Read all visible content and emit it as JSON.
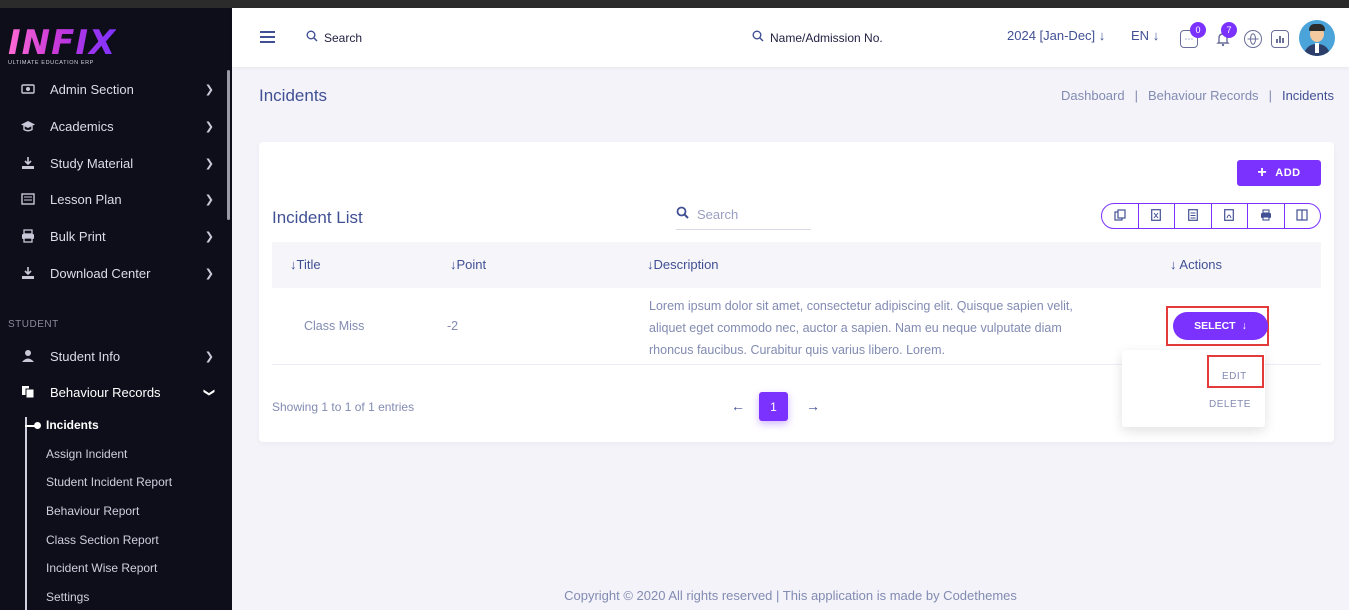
{
  "brand": {
    "logo": "INFIX",
    "tagline": "ULTIMATE EDUCATION ERP"
  },
  "sidebar": {
    "items": [
      {
        "label": "Admin Section",
        "icon": "admin-icon"
      },
      {
        "label": "Academics",
        "icon": "graduation-cap-icon"
      },
      {
        "label": "Study Material",
        "icon": "download-icon"
      },
      {
        "label": "Lesson Plan",
        "icon": "book-icon"
      },
      {
        "label": "Bulk Print",
        "icon": "printer-icon"
      },
      {
        "label": "Download Center",
        "icon": "download-icon"
      }
    ],
    "section_student": "STUDENT",
    "student_items": [
      {
        "label": "Student Info",
        "icon": "user-icon"
      },
      {
        "label": "Behaviour Records",
        "icon": "records-icon"
      }
    ],
    "sub_items": [
      "Incidents",
      "Assign Incident",
      "Student Incident Report",
      "Behaviour Report",
      "Class Section Report",
      "Incident Wise Report",
      "Settings"
    ]
  },
  "header": {
    "search_label": "Search",
    "search2_label": "Name/Admission No.",
    "year": "2024 [Jan-Dec]",
    "lang": "EN",
    "chat_badge": "0",
    "bell_badge": "7"
  },
  "page": {
    "title": "Incidents",
    "breadcrumb": [
      "Dashboard",
      "Behaviour Records",
      "Incidents"
    ]
  },
  "card": {
    "add_label": "ADD",
    "title": "Incident List",
    "search_placeholder": "Search",
    "columns": [
      "Title",
      "Point",
      "Description",
      "Actions"
    ],
    "rows": [
      {
        "title": "Class Miss",
        "point": "-2",
        "description": "Lorem ipsum dolor sit amet, consectetur adipiscing elit. Quisque sapien velit, aliquet eget commodo nec, auctor a sapien. Nam eu neque vulputate diam rhoncus faucibus. Curabitur quis varius libero. Lorem."
      }
    ],
    "select_label": "SELECT",
    "dropdown": {
      "edit": "EDIT",
      "delete": "DELETE"
    },
    "showing": "Showing 1 to 1 of 1 entries",
    "page": "1"
  },
  "footer": "Copyright © 2020 All rights reserved | This application is made by Codethemes",
  "colors": {
    "accent": "#7c32ff",
    "sidebar": "#0e0e1a",
    "text": "#415094",
    "muted": "#828bb2",
    "highlight": "#e33a3a"
  }
}
